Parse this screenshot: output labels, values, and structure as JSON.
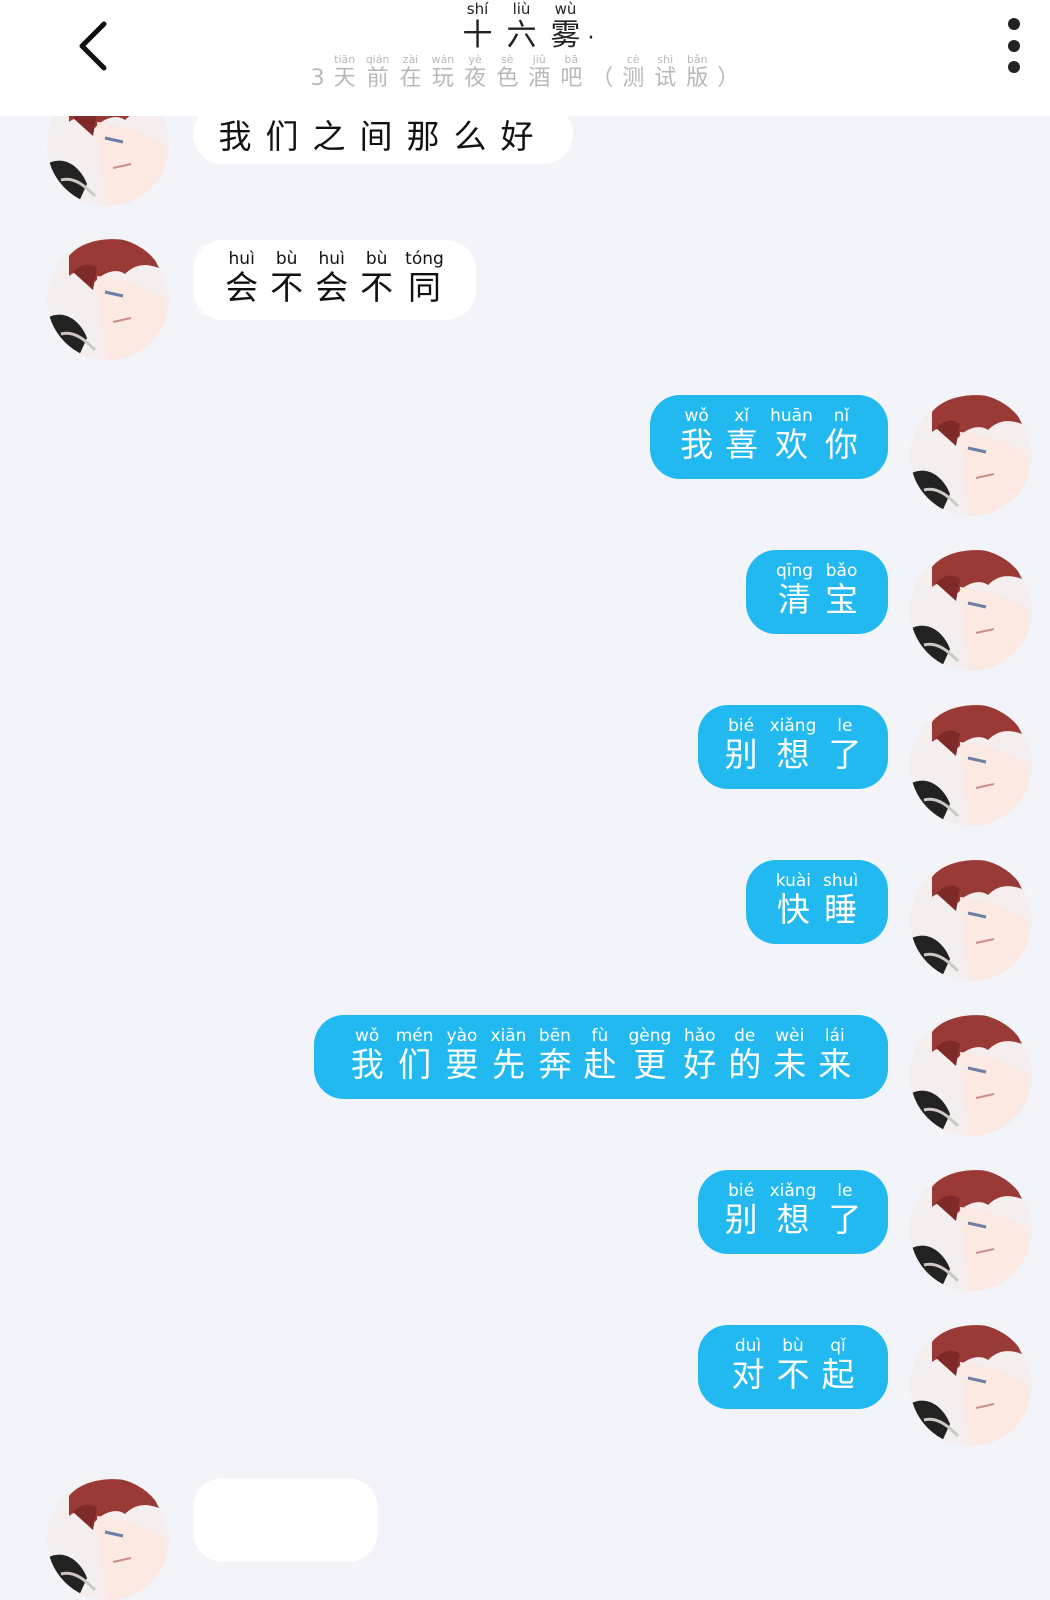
{
  "header": {
    "back_icon": "chevron-left-icon",
    "more_icon": "vertical-dots-icon",
    "title": [
      {
        "char": "十",
        "py": "shí"
      },
      {
        "char": "六",
        "py": "liù"
      },
      {
        "char": "雾",
        "py": "wù"
      }
    ],
    "title_suffix": "·",
    "subtitle": [
      {
        "char": "3",
        "py": ""
      },
      {
        "char": "天",
        "py": "tiān"
      },
      {
        "char": "前",
        "py": "qián"
      },
      {
        "char": "在",
        "py": "zài"
      },
      {
        "char": "玩",
        "py": "wán"
      },
      {
        "char": "夜",
        "py": "yè"
      },
      {
        "char": "色",
        "py": "sè"
      },
      {
        "char": "酒",
        "py": "jiǔ"
      },
      {
        "char": "吧",
        "py": "bā"
      },
      {
        "char": "（",
        "py": ""
      },
      {
        "char": "测",
        "py": "cè"
      },
      {
        "char": "试",
        "py": "shì"
      },
      {
        "char": "版",
        "py": "bǎn"
      },
      {
        "char": "）",
        "py": ""
      }
    ]
  },
  "messages": [
    {
      "side": "in",
      "plain": "我们之间那么好",
      "chars": []
    },
    {
      "side": "in",
      "plain": "",
      "chars": [
        {
          "char": "会",
          "py": "huì"
        },
        {
          "char": "不",
          "py": "bù"
        },
        {
          "char": "会",
          "py": "huì"
        },
        {
          "char": "不",
          "py": "bù"
        },
        {
          "char": "同",
          "py": "tóng"
        }
      ]
    },
    {
      "side": "out",
      "plain": "",
      "chars": [
        {
          "char": "我",
          "py": "wǒ"
        },
        {
          "char": "喜",
          "py": "xǐ"
        },
        {
          "char": "欢",
          "py": "huān"
        },
        {
          "char": "你",
          "py": "nǐ"
        }
      ]
    },
    {
      "side": "out",
      "plain": "",
      "chars": [
        {
          "char": "清",
          "py": "qīng"
        },
        {
          "char": "宝",
          "py": "bǎo"
        }
      ]
    },
    {
      "side": "out",
      "plain": "",
      "chars": [
        {
          "char": "别",
          "py": "bié"
        },
        {
          "char": "想",
          "py": "xiǎng"
        },
        {
          "char": "了",
          "py": "le"
        }
      ]
    },
    {
      "side": "out",
      "plain": "",
      "chars": [
        {
          "char": "快",
          "py": "kuài"
        },
        {
          "char": "睡",
          "py": "shuì"
        }
      ]
    },
    {
      "side": "out",
      "plain": "",
      "chars": [
        {
          "char": "我",
          "py": "wǒ"
        },
        {
          "char": "们",
          "py": "mén"
        },
        {
          "char": "要",
          "py": "yào"
        },
        {
          "char": "先",
          "py": "xiān"
        },
        {
          "char": "奔",
          "py": "bēn"
        },
        {
          "char": "赴",
          "py": "fù"
        },
        {
          "char": "更",
          "py": "gèng"
        },
        {
          "char": "好",
          "py": "hǎo"
        },
        {
          "char": "的",
          "py": "de"
        },
        {
          "char": "未",
          "py": "wèi"
        },
        {
          "char": "来",
          "py": "lái"
        }
      ]
    },
    {
      "side": "out",
      "plain": "",
      "chars": [
        {
          "char": "别",
          "py": "bié"
        },
        {
          "char": "想",
          "py": "xiǎng"
        },
        {
          "char": "了",
          "py": "le"
        }
      ]
    },
    {
      "side": "out",
      "plain": "",
      "chars": [
        {
          "char": "对",
          "py": "duì"
        },
        {
          "char": "不",
          "py": "bù"
        },
        {
          "char": "起",
          "py": "qǐ"
        }
      ]
    },
    {
      "side": "in",
      "plain": "",
      "chars": []
    }
  ]
}
